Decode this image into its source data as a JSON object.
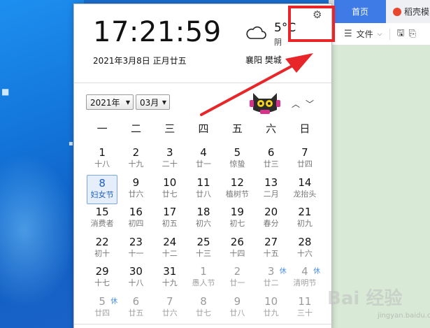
{
  "clock": {
    "time": "17:21:59",
    "date": "2021年3月8日 正月廿五"
  },
  "weather": {
    "temp": "5°C",
    "condition": "阴",
    "city": "襄阳 樊城",
    "icon": "cloud-icon"
  },
  "selectors": {
    "year": "2021年",
    "month": "03月"
  },
  "weekdays": [
    "一",
    "二",
    "三",
    "四",
    "五",
    "六",
    "日"
  ],
  "days": [
    {
      "num": "1",
      "lunar": "十八"
    },
    {
      "num": "2",
      "lunar": "十九"
    },
    {
      "num": "3",
      "lunar": "二十"
    },
    {
      "num": "4",
      "lunar": "廿一"
    },
    {
      "num": "5",
      "lunar": "惊蛰"
    },
    {
      "num": "6",
      "lunar": "廿三"
    },
    {
      "num": "7",
      "lunar": "廿四"
    },
    {
      "num": "8",
      "lunar": "妇女节",
      "today": true
    },
    {
      "num": "9",
      "lunar": "廿六"
    },
    {
      "num": "10",
      "lunar": "廿七"
    },
    {
      "num": "11",
      "lunar": "廿八"
    },
    {
      "num": "12",
      "lunar": "植树节"
    },
    {
      "num": "13",
      "lunar": "二月"
    },
    {
      "num": "14",
      "lunar": "龙抬头"
    },
    {
      "num": "15",
      "lunar": "消费者"
    },
    {
      "num": "16",
      "lunar": "初四"
    },
    {
      "num": "17",
      "lunar": "初五"
    },
    {
      "num": "18",
      "lunar": "初六"
    },
    {
      "num": "19",
      "lunar": "初七"
    },
    {
      "num": "20",
      "lunar": "春分"
    },
    {
      "num": "21",
      "lunar": "初九"
    },
    {
      "num": "22",
      "lunar": "初十"
    },
    {
      "num": "23",
      "lunar": "十一"
    },
    {
      "num": "24",
      "lunar": "十二"
    },
    {
      "num": "25",
      "lunar": "十三"
    },
    {
      "num": "26",
      "lunar": "十四"
    },
    {
      "num": "27",
      "lunar": "十五"
    },
    {
      "num": "28",
      "lunar": "十六"
    },
    {
      "num": "29",
      "lunar": "十七"
    },
    {
      "num": "30",
      "lunar": "十八"
    },
    {
      "num": "31",
      "lunar": "十九"
    },
    {
      "num": "1",
      "lunar": "愚人节",
      "other": true
    },
    {
      "num": "2",
      "lunar": "廿一",
      "other": true
    },
    {
      "num": "3",
      "lunar": "廿二",
      "other": true,
      "badge": "休"
    },
    {
      "num": "4",
      "lunar": "清明节",
      "other": true,
      "badge": "休"
    },
    {
      "num": "5",
      "lunar": "廿四",
      "other": true,
      "badge": "休"
    },
    {
      "num": "6",
      "lunar": "廿五",
      "other": true
    },
    {
      "num": "7",
      "lunar": "廿六",
      "other": true
    },
    {
      "num": "8",
      "lunar": "廿七",
      "other": true
    },
    {
      "num": "9",
      "lunar": "廿八",
      "other": true
    },
    {
      "num": "10",
      "lunar": "廿九",
      "other": true
    },
    {
      "num": "11",
      "lunar": "三十",
      "other": true
    }
  ],
  "app": {
    "tab_home": "首页",
    "tab_doc": "稻壳模",
    "file_menu": "文件"
  },
  "watermark": {
    "brand": "Bai 经验",
    "sub": "jingyan.baidu.com"
  },
  "colors": {
    "highlight": "#e8262a",
    "today_border": "#7aa8df",
    "holiday_badge": "#4a8ee8"
  }
}
